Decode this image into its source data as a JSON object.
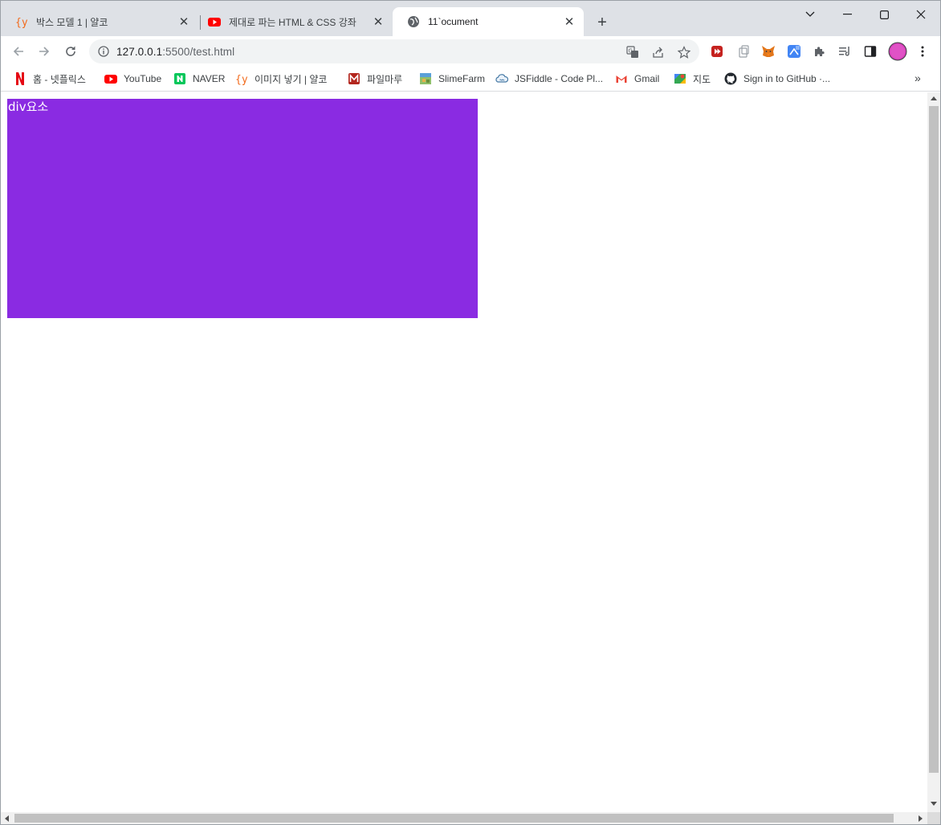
{
  "tabs": [
    {
      "title": "박스 모델 1 | 얄코",
      "favicon": "yalco-icon",
      "active": false
    },
    {
      "title": "제대로 파는 HTML & CSS 강좌",
      "favicon": "youtube-icon",
      "active": false
    },
    {
      "title": "11`ocument",
      "favicon": "globe-icon",
      "active": true
    }
  ],
  "address_bar": {
    "host": "127.0.0.1",
    "path": ":5500/test.html"
  },
  "bookmarks": [
    {
      "label": "홈 - 넷플릭스",
      "icon": "netflix-icon"
    },
    {
      "label": "YouTube",
      "icon": "youtube-icon"
    },
    {
      "label": "NAVER",
      "icon": "naver-icon"
    },
    {
      "label": "이미지 넣기 | 얄코",
      "icon": "yalco-icon"
    },
    {
      "label": "파일마루",
      "icon": "filemaru-icon"
    },
    {
      "label": "SlimeFarm",
      "icon": "slimefarm-icon"
    },
    {
      "label": "JSFiddle - Code Pl...",
      "icon": "jsfiddle-icon"
    },
    {
      "label": "Gmail",
      "icon": "gmail-icon"
    },
    {
      "label": "지도",
      "icon": "maps-icon"
    },
    {
      "label": "Sign in to GitHub ·...",
      "icon": "github-icon"
    }
  ],
  "page": {
    "div_text": "div요소"
  },
  "colors": {
    "box": "#8a2be2",
    "tabstrip": "#dee1e6"
  }
}
